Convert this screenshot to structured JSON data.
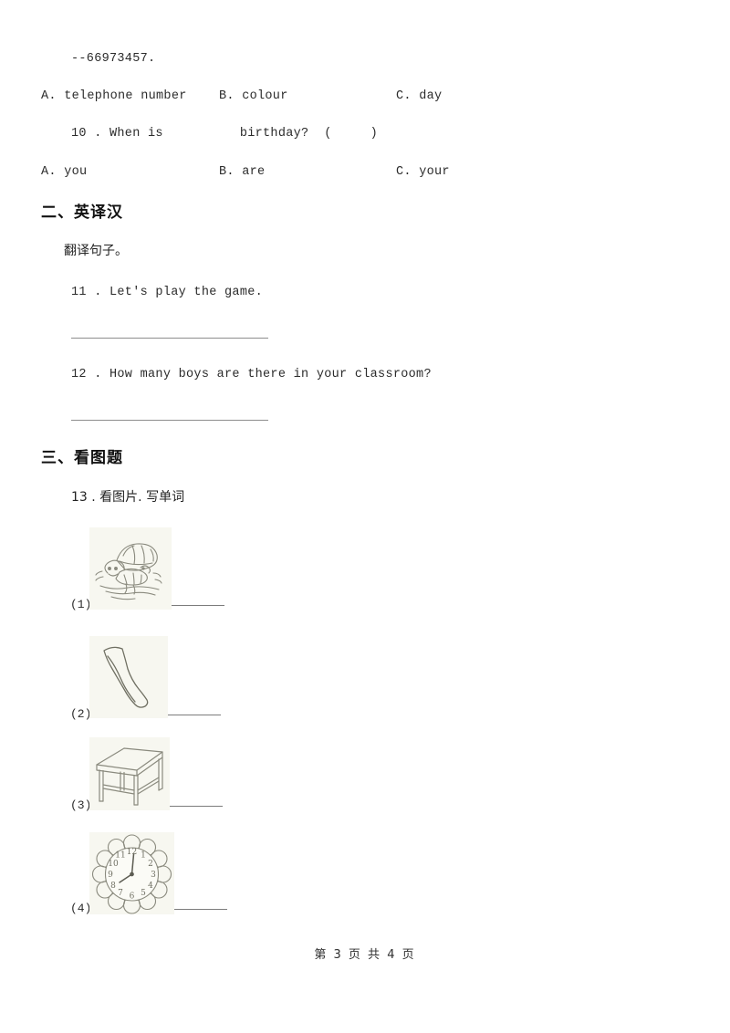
{
  "document": {
    "page_footer": "第 3 页 共 4 页"
  },
  "questions_top": {
    "q9_answer_line": "--66973457.",
    "q9_options": [
      {
        "label": "A. telephone number"
      },
      {
        "label": "B. colour"
      },
      {
        "label": "C. day"
      }
    ],
    "q10_text": "10 . When is          birthday?  (     )",
    "q10_options": [
      {
        "label": "A. you"
      },
      {
        "label": "B. are"
      },
      {
        "label": "C. your"
      }
    ]
  },
  "section_two": {
    "heading": "二、英译汉",
    "instruction": "翻译句子。",
    "items": [
      {
        "text": "11 . Let's play the game."
      },
      {
        "text": "12 . How many boys are there in your classroom?"
      }
    ]
  },
  "section_three": {
    "heading": "三、看图题",
    "instruction": "13 . 看图片. 写单词",
    "pictures": [
      {
        "number": "(1)",
        "icon": "turtle-drawing"
      },
      {
        "number": "(2)",
        "icon": "leg-drawing"
      },
      {
        "number": "(3)",
        "icon": "desk-drawing"
      },
      {
        "number": "(4)",
        "icon": "clock-drawing"
      }
    ]
  },
  "colors": {
    "text": "#2b2b2b",
    "rule": "#8d8d8d",
    "picture_bg": "#f7f7f0",
    "ink": "#8a8a7e"
  }
}
